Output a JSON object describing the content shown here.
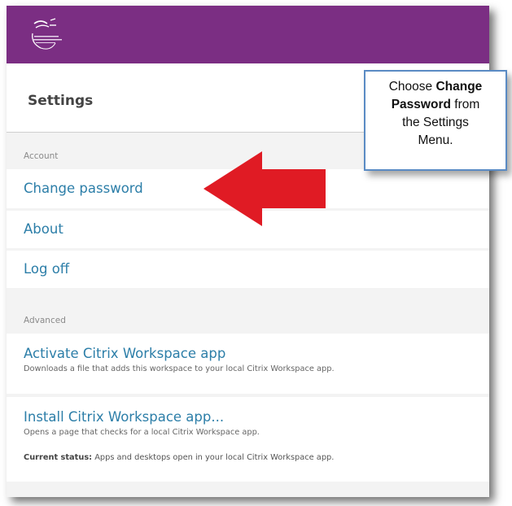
{
  "colors": {
    "brand": "#7b2e83",
    "link": "#2c7ea8",
    "arrow": "#e01b24",
    "callout_border": "#5a8bc4"
  },
  "header": {
    "title": "Settings",
    "logo_icon": "apple-logo-icon"
  },
  "account": {
    "label": "Account",
    "items": [
      {
        "label": "Change password"
      },
      {
        "label": "About"
      },
      {
        "label": "Log off"
      }
    ]
  },
  "advanced": {
    "label": "Advanced",
    "activate": {
      "title": "Activate Citrix Workspace app",
      "description": "Downloads a file that adds this workspace to your local Citrix Workspace app."
    },
    "install": {
      "title": "Install Citrix Workspace app...",
      "description": "Opens a page that checks for a local Citrix Workspace app.",
      "status_label": "Current status:",
      "status_text": " Apps and desktops open in your local Citrix Workspace app."
    }
  },
  "callout": {
    "text_1": "Choose ",
    "text_bold_1": "Change",
    "text_bold_2": "Password",
    "text_2": " from",
    "text_3": "the Settings",
    "text_4": "Menu."
  }
}
